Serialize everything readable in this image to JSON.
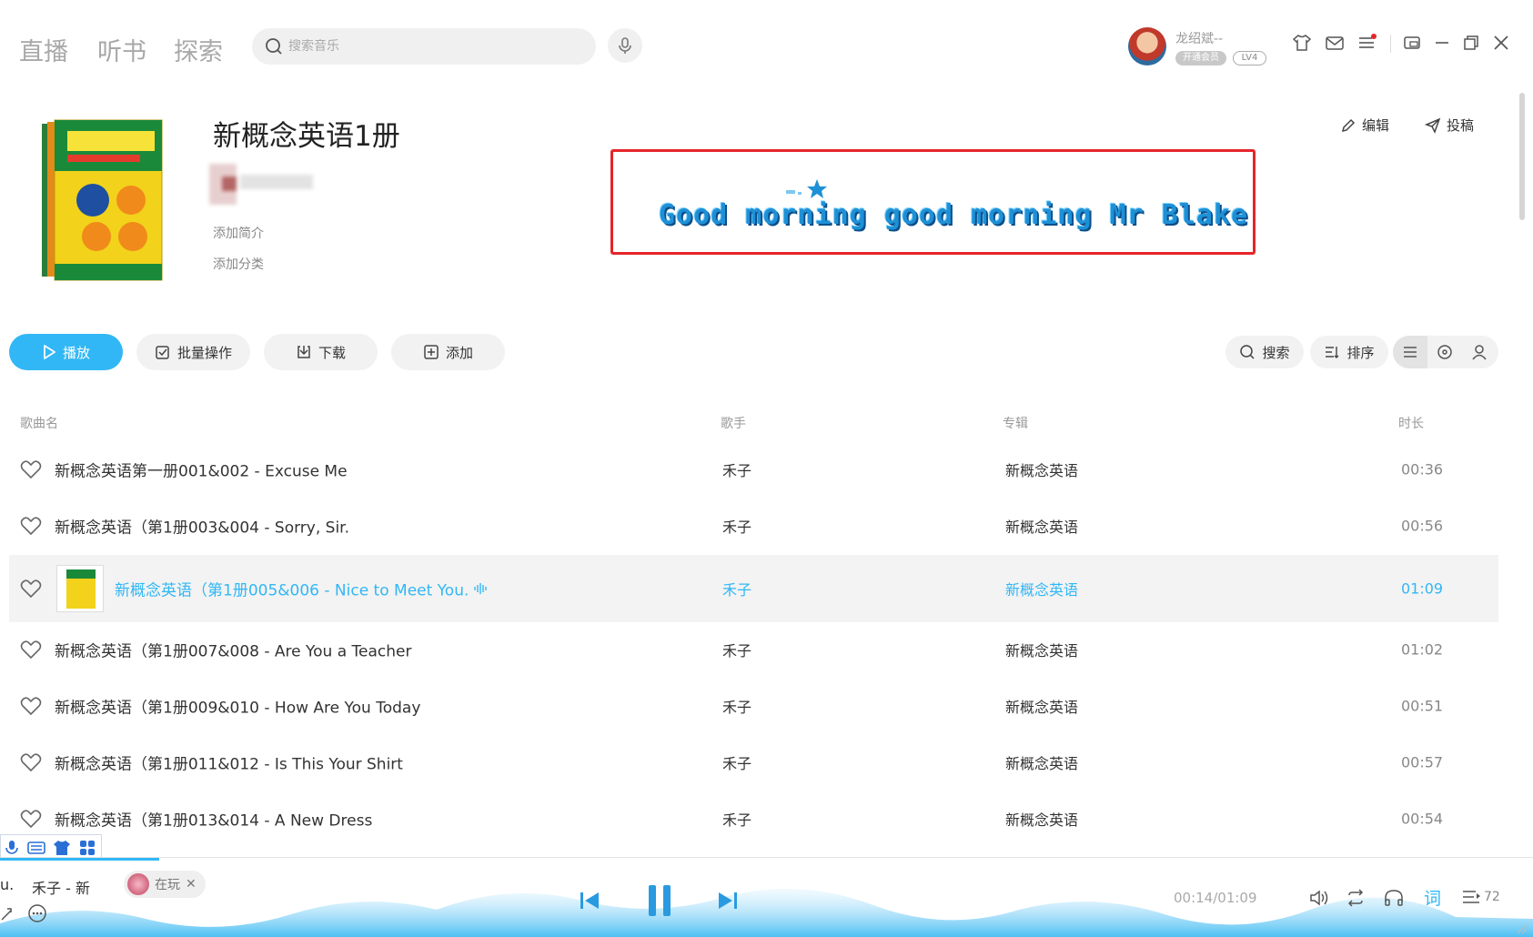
{
  "nav": {
    "tabs": [
      "直播",
      "听书",
      "探索"
    ]
  },
  "search": {
    "placeholder": "搜索音乐"
  },
  "user": {
    "name": "龙绍斌--",
    "vip_label": "开通会员",
    "level": "LV4"
  },
  "playlist": {
    "title": "新概念英语1册",
    "add_intro": "添加简介",
    "add_category": "添加分类",
    "edit_label": "编辑",
    "submit_label": "投稿"
  },
  "lyric": {
    "text": "Good morning good morning Mr Blake"
  },
  "toolbar": {
    "play": "播放",
    "batch": "批量操作",
    "download": "下载",
    "add": "添加",
    "search": "搜索",
    "sort": "排序"
  },
  "table": {
    "headers": {
      "song": "歌曲名",
      "singer": "歌手",
      "album": "专辑",
      "duration": "时长"
    },
    "rows": [
      {
        "song": "新概念英语第一册001&002 - Excuse Me",
        "singer": "禾子",
        "album": "新概念英语",
        "duration": "00:36"
      },
      {
        "song": "新概念英语（第1册003&004 - Sorry, Sir.",
        "singer": "禾子",
        "album": "新概念英语",
        "duration": "00:56"
      },
      {
        "song": "新概念英语（第1册005&006 - Nice to Meet You.",
        "singer": "禾子",
        "album": "新概念英语",
        "duration": "01:09"
      },
      {
        "song": "新概念英语（第1册007&008 - Are You a Teacher",
        "singer": "禾子",
        "album": "新概念英语",
        "duration": "01:02"
      },
      {
        "song": "新概念英语（第1册009&010 - How Are You Today",
        "singer": "禾子",
        "album": "新概念英语",
        "duration": "00:51"
      },
      {
        "song": "新概念英语（第1册011&012 - Is This Your Shirt",
        "singer": "禾子",
        "album": "新概念英语",
        "duration": "00:57"
      },
      {
        "song": "新概念英语（第1册013&014 - A New Dress",
        "singer": "禾子",
        "album": "新概念英语",
        "duration": "00:54"
      }
    ]
  },
  "player": {
    "now_playing": "禾子 - 新",
    "prefix": "u.",
    "tag": "在玩",
    "time": "00:14/01:09",
    "lyric_btn": "词",
    "queue_count": "72",
    "progress": 0.2
  },
  "colors": {
    "accent": "#31b7f5",
    "lyric_box": "#e5252a"
  }
}
